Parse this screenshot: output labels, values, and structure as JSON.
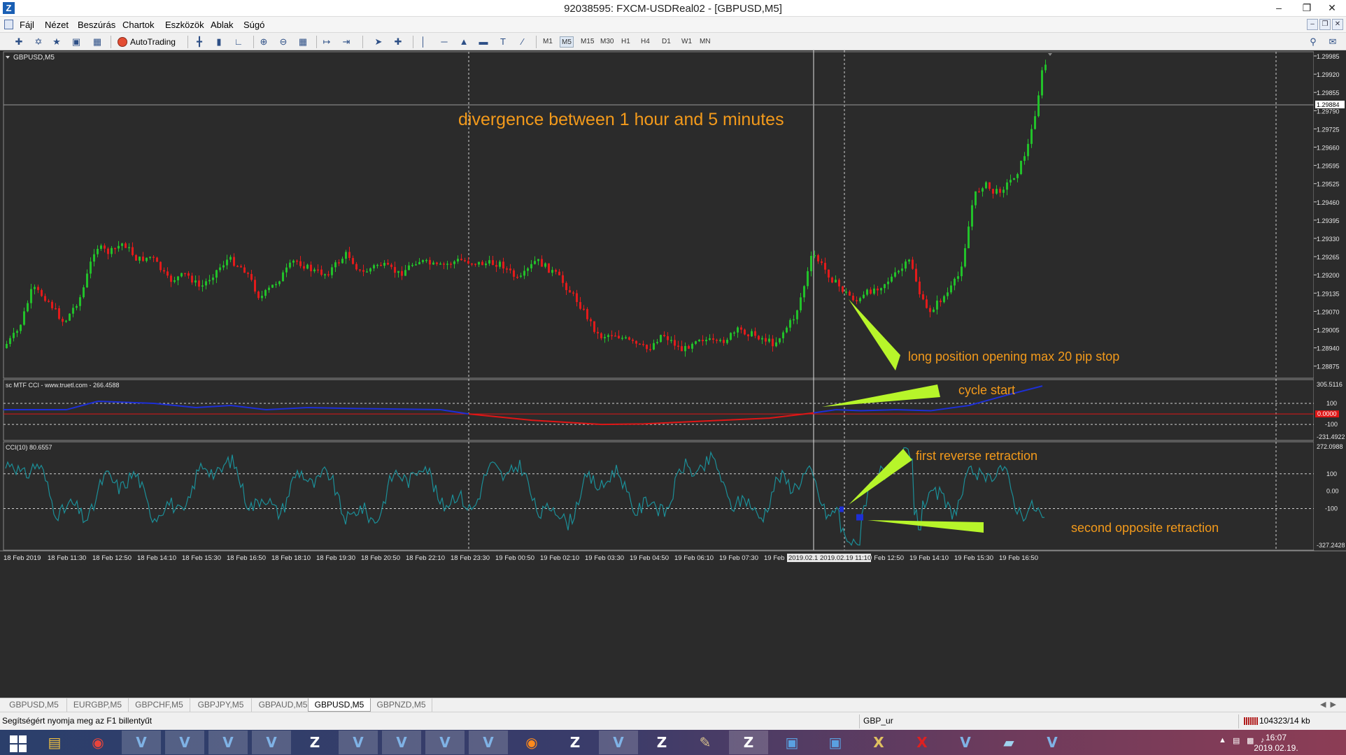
{
  "window": {
    "title": "92038595: FXCM-USDReal02 - [GBPUSD,M5]",
    "app_icon_letter": "Z"
  },
  "menu": {
    "items": [
      "Fájl",
      "Nézet",
      "Beszúrás",
      "Chartok",
      "Eszközök",
      "Ablak",
      "Súgó"
    ]
  },
  "toolbar": {
    "autotrading_label": "AutoTrading",
    "timeframes": [
      "M1",
      "M5",
      "M15",
      "M30",
      "H1",
      "H4",
      "D1",
      "W1",
      "MN"
    ],
    "active_timeframe": "M5"
  },
  "chart": {
    "symbol_label": "GBPUSD,M5",
    "current_price_label": "1.29884",
    "price_ticks": [
      "1.29985",
      "1.29920",
      "1.29855",
      "1.29790",
      "1.29725",
      "1.29660",
      "1.29595",
      "1.29525",
      "1.29460",
      "1.29395",
      "1.29330",
      "1.29265",
      "1.29200",
      "1.29135",
      "1.29070",
      "1.29005",
      "1.28940",
      "1.28875"
    ],
    "annotations": {
      "divergence": "divergence between 1 hour and 5 minutes",
      "long_position": "long position opening max 20 pip stop",
      "cycle_start": "cycle start",
      "first_retraction": "first reverse retraction",
      "second_retraction": "second opposite retraction"
    },
    "mtf_cci": {
      "label": "sc MTF CCI - www.truetl.com - 266.4588",
      "top_value": "305.5116",
      "level_100": "100",
      "zero_badge": "0.0000",
      "level_minus100": "-100",
      "bottom_value": "-231.4922"
    },
    "cci": {
      "label": "CCI(10) 80.6557",
      "top_value": "272.0988",
      "level_100": "100",
      "level_0": "0.00",
      "level_minus100": "-100",
      "bottom_value": "-327.2428"
    },
    "time_ticks": [
      "18 Feb 2019",
      "18 Feb 11:30",
      "18 Feb 12:50",
      "18 Feb 14:10",
      "18 Feb 15:30",
      "18 Feb 16:50",
      "18 Feb 18:10",
      "18 Feb 19:30",
      "18 Feb 20:50",
      "18 Feb 22:10",
      "18 Feb 23:30",
      "19 Feb 00:50",
      "19 Feb 02:10",
      "19 Feb 03:30",
      "19 Feb 04:50",
      "19 Feb 06:10",
      "19 Feb 07:30",
      "19 Feb",
      "",
      "11:30",
      "19 Feb 12:50",
      "19 Feb 14:10",
      "19 Feb 15:30",
      "19 Feb 16:50"
    ],
    "crosshair_time_1": "2019.02.1",
    "crosshair_time_2": "2019.02.19 11:10",
    "colors": {
      "background": "#2b2b2b",
      "bull": "#22c12a",
      "bear": "#e21b1b",
      "annotation_text": "#f39a1b",
      "annotation_arrow": "#b7f52a",
      "cci_line": "#1b8f98",
      "mtf_up": "#1d2fd6",
      "mtf_down": "#e01616"
    }
  },
  "tabs": {
    "items": [
      "GBPUSD,M5",
      "EURGBP,M5",
      "GBPCHF,M5",
      "GBPJPY,M5",
      "GBPAUD,M5",
      "GBPUSD,M5",
      "GBPNZD,M5"
    ],
    "active_index": 5
  },
  "status": {
    "help": "Segítségért nyomja meg az F1 billentyűt",
    "profile": "GBP_ur",
    "traffic": "104323/14 kb"
  },
  "taskbar": {
    "time": "16:07",
    "date": "2019.02.19."
  }
}
